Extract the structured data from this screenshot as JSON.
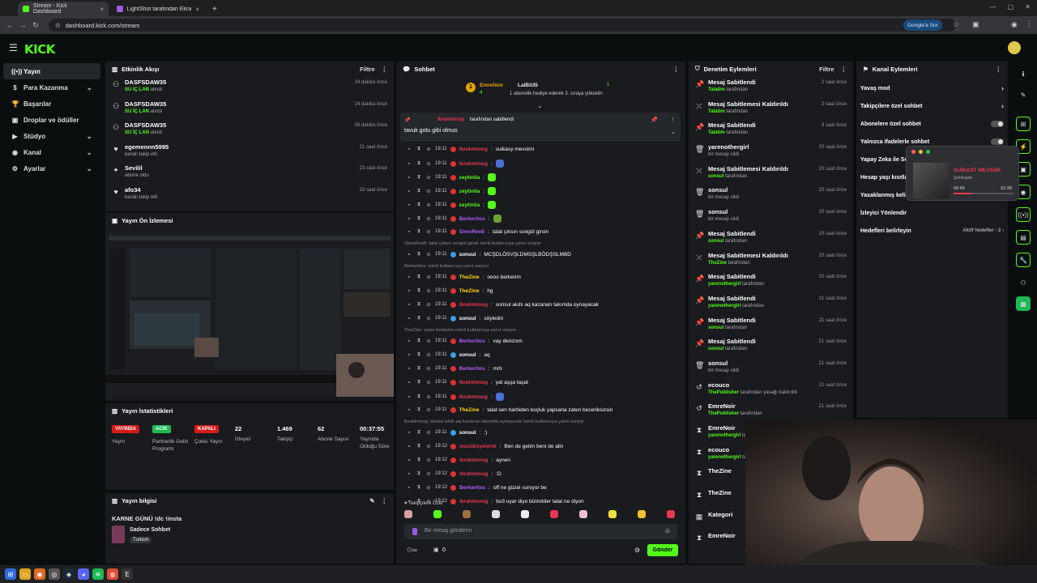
{
  "browser": {
    "tabs": [
      {
        "title": "Stream - Kick Dashboard",
        "fav_color": "#53fc18"
      },
      {
        "title": "LightShot tarafından Ekran Görü",
        "fav_color": "#a05ae0"
      }
    ],
    "new_tab": "+",
    "url": "dashboard.kick.com/stream",
    "google_sor": "Google'a Sor"
  },
  "header": {
    "logo": "KICK"
  },
  "sidebar": {
    "items": [
      {
        "label": "Yayın",
        "icon": "broadcast-icon",
        "active": true
      },
      {
        "label": "Para Kazanma",
        "icon": "money-icon",
        "chevron": true
      },
      {
        "label": "Başarılar",
        "icon": "trophy-icon"
      },
      {
        "label": "Droplar ve ödüller",
        "icon": "gift-icon"
      },
      {
        "label": "Stüdyo",
        "icon": "studio-icon",
        "chevron": true
      },
      {
        "label": "Kanal",
        "icon": "channel-icon",
        "chevron": true
      },
      {
        "label": "Ayarlar",
        "icon": "gear-icon",
        "chevron": true
      }
    ]
  },
  "activity": {
    "title": "Etkinlik Akışı",
    "filter": "Filtre",
    "items": [
      {
        "name": "DASFSDAW35",
        "sub_bold": "SU İÇ LAN",
        "sub": " alındı",
        "time": "24 dakika önce",
        "icon": "sub-icon"
      },
      {
        "name": "DASFSDAW35",
        "sub_bold": "SU İÇ LAN",
        "sub": " alındı",
        "time": "24 dakika önce",
        "icon": "sub-icon"
      },
      {
        "name": "DASFSDAW35",
        "sub_bold": "SU İÇ LAN",
        "sub": " alındı",
        "time": "26 dakika önce",
        "icon": "sub-icon"
      },
      {
        "name": "egemennn5995",
        "sub_bold": "",
        "sub": "kanalı takip etti",
        "time": "21 saat önce",
        "icon": "heart-icon"
      },
      {
        "name": "Sevilil",
        "sub_bold": "",
        "sub": "abone oldu",
        "time": "23 saat önce",
        "icon": "star-icon"
      },
      {
        "name": "afo34",
        "sub_bold": "",
        "sub": "kanalı takip etti",
        "time": "23 saat önce",
        "icon": "heart-icon"
      }
    ]
  },
  "preview": {
    "title": "Yayın Ön İzlemesi"
  },
  "stats": {
    "title": "Yayın İstatistikleri",
    "items": [
      {
        "badge": "YAYINDA",
        "color": "#d61a1a",
        "label": "Yayın"
      },
      {
        "badge": "ACIK",
        "color": "#1db954",
        "label": "Partnerlik Geliri Programı"
      },
      {
        "badge": "KAPALI",
        "color": "#d61a1a",
        "label": "Çoklu Yayın"
      },
      {
        "value": "22",
        "label": "İzleyici"
      },
      {
        "value": "1.469",
        "label": "Takipçi"
      },
      {
        "value": "62",
        "label": "Abone Sayısı"
      },
      {
        "value": "00:37:55",
        "label": "Yayında Olduğu Süre"
      }
    ]
  },
  "info": {
    "title": "Yayın bilgisi",
    "stream_title": "KARNE GÜNÜ !dc !insta",
    "category": "Sadece Sohbet",
    "language": "Turkish"
  },
  "chat": {
    "title": "Sohbet",
    "top_gifter": {
      "name": "EmreNoir",
      "count": "4"
    },
    "top_user": {
      "name": "LalBii35",
      "count": "1",
      "msg": "1 abonelik hediye ederek 3. sıraya yükselin"
    },
    "pinned": {
      "by_name": "lbrahimnog",
      "by_text": " tarafından sabitlendi",
      "text": "tavuk gotu gibi olmus"
    },
    "messages": [
      {
        "time": "19:11",
        "user": "lbrahimnog",
        "color": "#e8384f",
        "text": "suikasy mevsimi"
      },
      {
        "time": "19:11",
        "user": "lbrahimnog",
        "color": "#e8384f",
        "text": "",
        "emote": "#4a6fd6"
      },
      {
        "time": "19:11",
        "user": "zeytinlia",
        "color": "#53fc18",
        "text": "",
        "emote": "#53fc18"
      },
      {
        "time": "19:11",
        "user": "zeytinlia",
        "color": "#53fc18",
        "text": "",
        "emote": "#53fc18"
      },
      {
        "time": "19:11",
        "user": "zeytinlia",
        "color": "#53fc18",
        "text": "",
        "emote": "#53fc18"
      },
      {
        "time": "19:11",
        "user": "Berkeritos",
        "color": "#b05cf5",
        "text": "",
        "emote": "#6aa332"
      },
      {
        "time": "19:11",
        "user": "SimoRee8",
        "color": "#b05cf5",
        "text": "talat çıksın songül girsin"
      },
      {
        "time": "19:11",
        "user": "sonsul",
        "color": "#ffffff",
        "text": "MCŞDLÖSVŞLDMSŞLBÖDŞSLMBD",
        "reply": "SimoRee8: talat çıksın songül girsin isimli kullanıcıya yanıt veriyor"
      },
      {
        "time": "19:11",
        "user": "TheZine",
        "color": "#ffd700",
        "text": "oooo berkerim",
        "reply": "Berkeritos:  isimli kullanıcıya yanıt veriyor"
      },
      {
        "time": "19:11",
        "user": "TheZine",
        "color": "#ffd700",
        "text": "hg"
      },
      {
        "time": "19:11",
        "user": "lbrahimnog",
        "color": "#e8384f",
        "text": "sonsul akıllı aq kazanan takımda oynayacak"
      },
      {
        "time": "19:11",
        "user": "sonsul",
        "color": "#ffffff",
        "text": "söyledin"
      },
      {
        "time": "19:11",
        "user": "Berkeritos",
        "color": "#b05cf5",
        "text": "vay denizxm",
        "reply": "TheZine: oooo berkerim isimli kullanıcıya yanıt veriyor"
      },
      {
        "time": "19:11",
        "user": "sonsul",
        "color": "#ffffff",
        "text": "aq"
      },
      {
        "time": "19:11",
        "user": "Berkeritos",
        "color": "#b05cf5",
        "text": "mrb"
      },
      {
        "time": "19:11",
        "user": "lbrahimnog",
        "color": "#e8384f",
        "text": "yat aşşa taşat"
      },
      {
        "time": "19:11",
        "user": "lbrahimnog",
        "color": "#e8384f",
        "text": "",
        "emote": "#4a6fd6"
      },
      {
        "time": "19:11",
        "user": "TheZine",
        "color": "#ffd700",
        "text": "talat sen harbiden koçluk yapsana zaten beceriksizsin"
      },
      {
        "time": "19:11",
        "user": "sonsul",
        "color": "#ffffff",
        "text": ":)",
        "reply": "lbrahimnog: sonsul akıllı aq kazanan takımda oynayacak isimli kullanıcıya yanıt veriyor"
      },
      {
        "time": "19:12",
        "user": "mustiksyelerdi",
        "color": "#e8384f",
        "text": "Ben de gelim beni de alin"
      },
      {
        "time": "19:12",
        "user": "lbrahimnog",
        "color": "#e8384f",
        "text": "aynen"
      },
      {
        "time": "19:12",
        "user": "lbrahimnog",
        "color": "#e8384f",
        "text": ":D"
      },
      {
        "time": "19:12",
        "user": "Berkeritos",
        "color": "#b05cf5",
        "text": "off ne güzel ısınıyor be"
      },
      {
        "time": "19:12",
        "user": "lbrahimnog",
        "color": "#e8384f",
        "text": "bo3 uyar diyo bizimkiler talat ne diyon"
      }
    ],
    "emote_bar_label": "Takipçilere Özel",
    "input_placeholder": "Bir mesaj gönderin",
    "points": "0",
    "send": "Gönder"
  },
  "moderation": {
    "title": "Denetim Eylemleri",
    "filter": "Filtre",
    "items": [
      {
        "name": "Mesaj Sabitlendi",
        "by": "Talatim",
        "sub": " tarafından",
        "time": "2 saat önce",
        "icon": "pin-icon"
      },
      {
        "name": "Mesaj Sabitlemesi Kaldırıldı",
        "by": "Talatim",
        "sub": " tarafından",
        "time": "2 saat önce",
        "icon": "unpin-icon"
      },
      {
        "name": "Mesaj Sabitlendi",
        "by": "Talatim",
        "sub": " tarafından",
        "time": "3 saat önce",
        "icon": "pin-icon"
      },
      {
        "name": "yarenothergirl",
        "by": "",
        "sub": "bir mesajı sildi",
        "time": "20 saat önce",
        "icon": "trash-icon"
      },
      {
        "name": "Mesaj Sabitlemesi Kaldırıldı",
        "by": "sonsul",
        "sub": " tarafından",
        "time": "20 saat önce",
        "icon": "unpin-icon"
      },
      {
        "name": "sonsul",
        "by": "",
        "sub": "bir mesajı sildi",
        "time": "20 saat önce",
        "icon": "trash-icon"
      },
      {
        "name": "sonsul",
        "by": "",
        "sub": "bir mesajı sildi",
        "time": "20 saat önce",
        "icon": "trash-icon"
      },
      {
        "name": "Mesaj Sabitlendi",
        "by": "sonsul",
        "sub": " tarafından",
        "time": "20 saat önce",
        "icon": "pin-icon"
      },
      {
        "name": "Mesaj Sabitlemesi Kaldırıldı",
        "by": "TheZine",
        "sub": " tarafından",
        "time": "20 saat önce",
        "icon": "unpin-icon"
      },
      {
        "name": "Mesaj Sabitlendi",
        "by": "yarenothergirl",
        "sub": " tarafından",
        "time": "20 saat önce",
        "icon": "pin-icon"
      },
      {
        "name": "Mesaj Sabitlendi",
        "by": "yarenothergirl",
        "sub": " tarafından",
        "time": "21 saat önce",
        "icon": "pin-icon"
      },
      {
        "name": "Mesaj Sabitlendi",
        "by": "sonsul",
        "sub": " tarafından",
        "time": "21 saat önce",
        "icon": "pin-icon"
      },
      {
        "name": "Mesaj Sabitlendi",
        "by": "sonsul",
        "sub": " tarafından",
        "time": "21 saat önce",
        "icon": "pin-icon"
      },
      {
        "name": "sonsul",
        "by": "",
        "sub": "bir mesajı sildi",
        "time": "21 saat önce",
        "icon": "trash-icon"
      },
      {
        "name": "ecouco",
        "by": "ThePublisher",
        "sub": " tarafından yasağı kaldırıldı",
        "time": "21 saat önce",
        "icon": "undo-icon"
      },
      {
        "name": "EmreNoir",
        "by": "ThePublisher",
        "sub": " tarafından",
        "time": "21 saat önce",
        "icon": "undo-icon"
      },
      {
        "name": "EmreNoir",
        "by": "yarenothergirl",
        "sub": " tarafından uzaklaştırıldı",
        "time": "",
        "icon": "timer-icon"
      },
      {
        "name": "ecouco",
        "by": "yarenothergirl",
        "sub": " tarafından uzaklaştırıldı",
        "time": "",
        "icon": "timer-icon"
      },
      {
        "name": "TheZine",
        "by": "",
        "sub": "",
        "time": "",
        "icon": "timer-icon"
      },
      {
        "name": "TheZine",
        "by": "",
        "sub": "",
        "time": "",
        "icon": "timer-icon"
      },
      {
        "name": "Kategori",
        "by": "",
        "sub": "",
        "time": "",
        "icon": "calendar-icon"
      },
      {
        "name": "EmreNoir",
        "by": "",
        "sub": "",
        "time": "",
        "icon": "timer-icon"
      }
    ]
  },
  "channel": {
    "title": "Kanal Eylemleri",
    "items": [
      {
        "label": "Yavaş mod",
        "right": "›"
      },
      {
        "label": "Takipçilere özel sohbet",
        "right": "›"
      },
      {
        "label": "Abonelere özel sohbet",
        "toggle": true
      },
      {
        "label": "Yalnızca ifadelerle sohbet",
        "toggle": true
      },
      {
        "label": "Yapay Zeka ile Sohbet",
        "right": ""
      },
      {
        "label": "Hesap yaşı kısıtla",
        "right": ""
      },
      {
        "label": "Yasaklanmış kelimeler",
        "right": ""
      },
      {
        "label": "İzleyici Yönlendir",
        "right": ""
      },
      {
        "label": "Hedefleri belirleyin",
        "right": "Aktif hedefler - 2  ›"
      }
    ]
  },
  "popup": {
    "title": "SUİKAST MEVSİMİ",
    "artist": "Şehinşah",
    "time_current": "00:45",
    "time_total": "02:28",
    "progress": 0.3
  }
}
